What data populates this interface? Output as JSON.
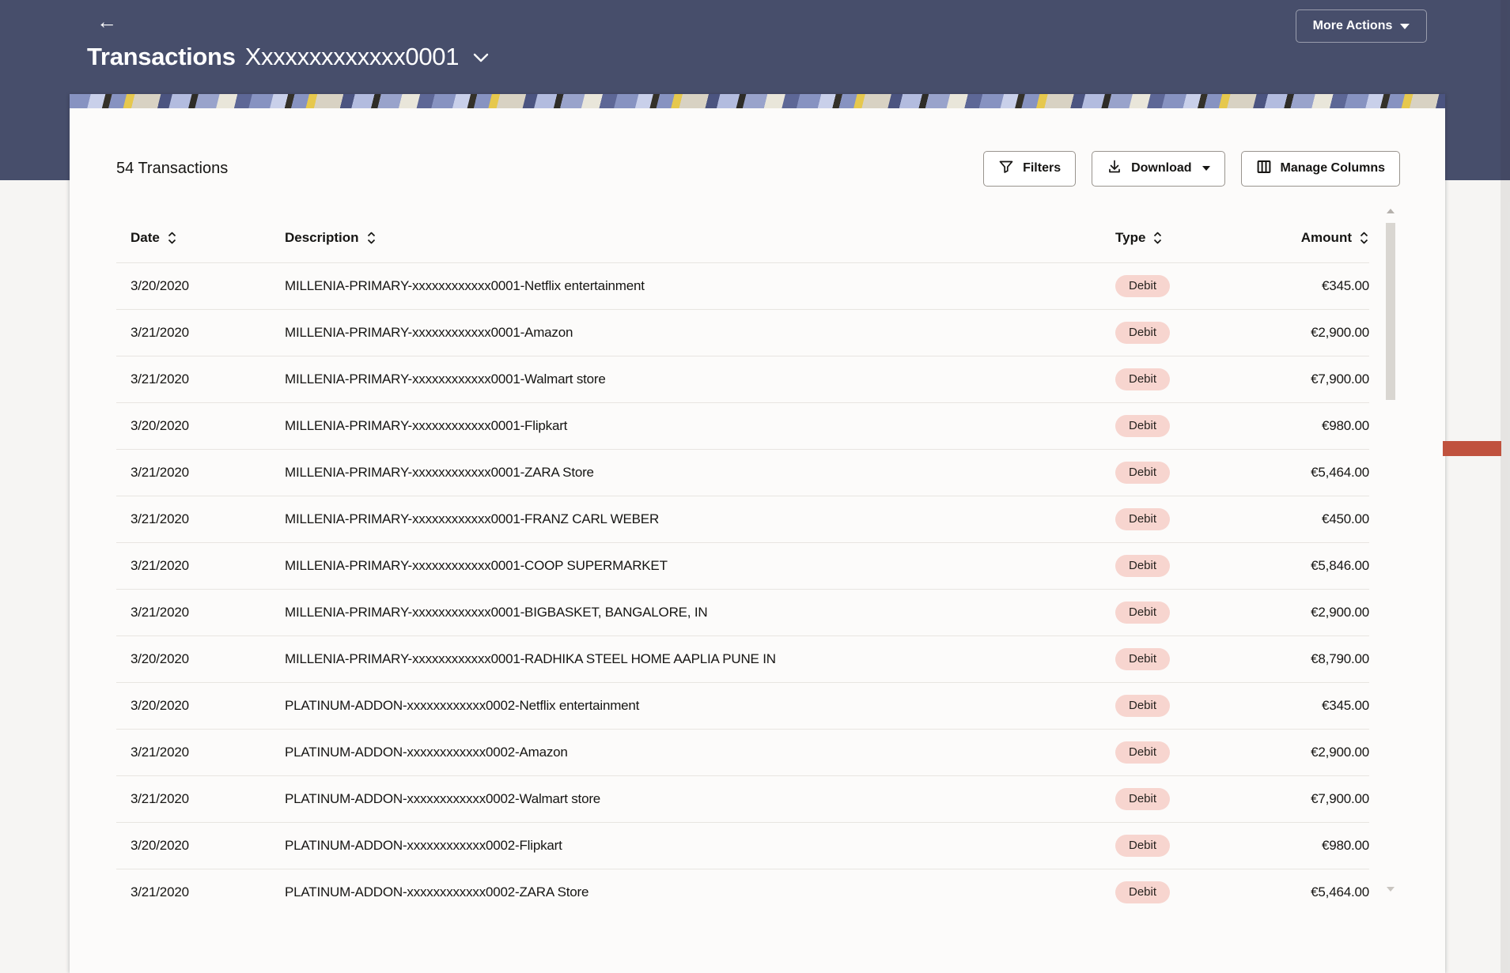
{
  "header": {
    "back_icon": "←",
    "title": "Transactions",
    "account_mask": "Xxxxxxxxxxxxx0001",
    "more_actions_label": "More Actions"
  },
  "toolbar": {
    "count_label": "54 Transactions",
    "filters_label": "Filters",
    "download_label": "Download",
    "manage_columns_label": "Manage Columns"
  },
  "table": {
    "columns": [
      {
        "label": "Date"
      },
      {
        "label": "Description"
      },
      {
        "label": "Type"
      },
      {
        "label": "Amount"
      }
    ],
    "rows": [
      {
        "date": "3/20/2020",
        "description": "MILLENIA-PRIMARY-xxxxxxxxxxxx0001-Netflix entertainment",
        "type": "Debit",
        "amount": "€345.00"
      },
      {
        "date": "3/21/2020",
        "description": "MILLENIA-PRIMARY-xxxxxxxxxxxx0001-Amazon",
        "type": "Debit",
        "amount": "€2,900.00"
      },
      {
        "date": "3/21/2020",
        "description": "MILLENIA-PRIMARY-xxxxxxxxxxxx0001-Walmart store",
        "type": "Debit",
        "amount": "€7,900.00"
      },
      {
        "date": "3/20/2020",
        "description": "MILLENIA-PRIMARY-xxxxxxxxxxxx0001-Flipkart",
        "type": "Debit",
        "amount": "€980.00"
      },
      {
        "date": "3/21/2020",
        "description": "MILLENIA-PRIMARY-xxxxxxxxxxxx0001-ZARA Store",
        "type": "Debit",
        "amount": "€5,464.00"
      },
      {
        "date": "3/21/2020",
        "description": "MILLENIA-PRIMARY-xxxxxxxxxxxx0001-FRANZ CARL WEBER",
        "type": "Debit",
        "amount": "€450.00"
      },
      {
        "date": "3/21/2020",
        "description": "MILLENIA-PRIMARY-xxxxxxxxxxxx0001-COOP SUPERMARKET",
        "type": "Debit",
        "amount": "€5,846.00"
      },
      {
        "date": "3/21/2020",
        "description": "MILLENIA-PRIMARY-xxxxxxxxxxxx0001-BIGBASKET, BANGALORE, IN",
        "type": "Debit",
        "amount": "€2,900.00"
      },
      {
        "date": "3/20/2020",
        "description": "MILLENIA-PRIMARY-xxxxxxxxxxxx0001-RADHIKA STEEL HOME AAPLIA PUNE IN",
        "type": "Debit",
        "amount": "€8,790.00"
      },
      {
        "date": "3/20/2020",
        "description": "PLATINUM-ADDON-xxxxxxxxxxxx0002-Netflix entertainment",
        "type": "Debit",
        "amount": "€345.00"
      },
      {
        "date": "3/21/2020",
        "description": "PLATINUM-ADDON-xxxxxxxxxxxx0002-Amazon",
        "type": "Debit",
        "amount": "€2,900.00"
      },
      {
        "date": "3/21/2020",
        "description": "PLATINUM-ADDON-xxxxxxxxxxxx0002-Walmart store",
        "type": "Debit",
        "amount": "€7,900.00"
      },
      {
        "date": "3/20/2020",
        "description": "PLATINUM-ADDON-xxxxxxxxxxxx0002-Flipkart",
        "type": "Debit",
        "amount": "€980.00"
      },
      {
        "date": "3/21/2020",
        "description": "PLATINUM-ADDON-xxxxxxxxxxxx0002-ZARA Store",
        "type": "Debit",
        "amount": "€5,464.00"
      }
    ]
  },
  "colors": {
    "header_navy": "#474e6b",
    "page_bg": "#f6f5f3",
    "card_bg": "#fcfbfa",
    "badge_bg": "#f7d5cf",
    "row_divider": "#e8e5e1",
    "scroll_marker_red": "#c0523e",
    "text_dark": "#161513"
  }
}
